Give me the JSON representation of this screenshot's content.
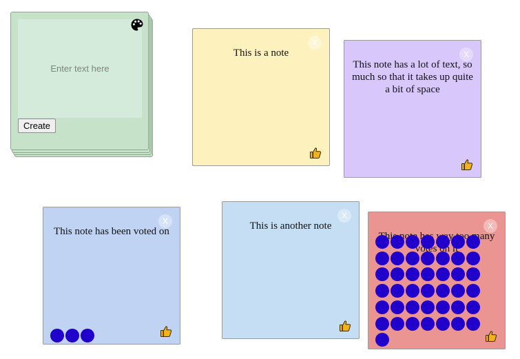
{
  "creator": {
    "placeholder": "Enter text here",
    "create_label": "Create",
    "palette_icon": "palette-icon",
    "color": "#c6e2c8"
  },
  "notes": [
    {
      "text": "This is a note",
      "close": "X",
      "color": "#fdf1bd",
      "votes": 0
    },
    {
      "text": "This note has a lot of text, so much so that it takes up quite a bit of space",
      "close": "X",
      "color": "#d8c7fa",
      "votes": 0
    },
    {
      "text": "This note has been voted on",
      "close": "X",
      "color": "#c1d3f3",
      "votes": 3
    },
    {
      "text": "This is another note",
      "close": "X",
      "color": "#c5def4",
      "votes": 0
    },
    {
      "text": "This note has way too many votes on it",
      "close": "X",
      "color": "#eb9593",
      "votes": 43
    }
  ],
  "icons": {
    "like": "thumbs-up-icon",
    "close": "close-icon"
  },
  "vote_color": "#2200cc"
}
